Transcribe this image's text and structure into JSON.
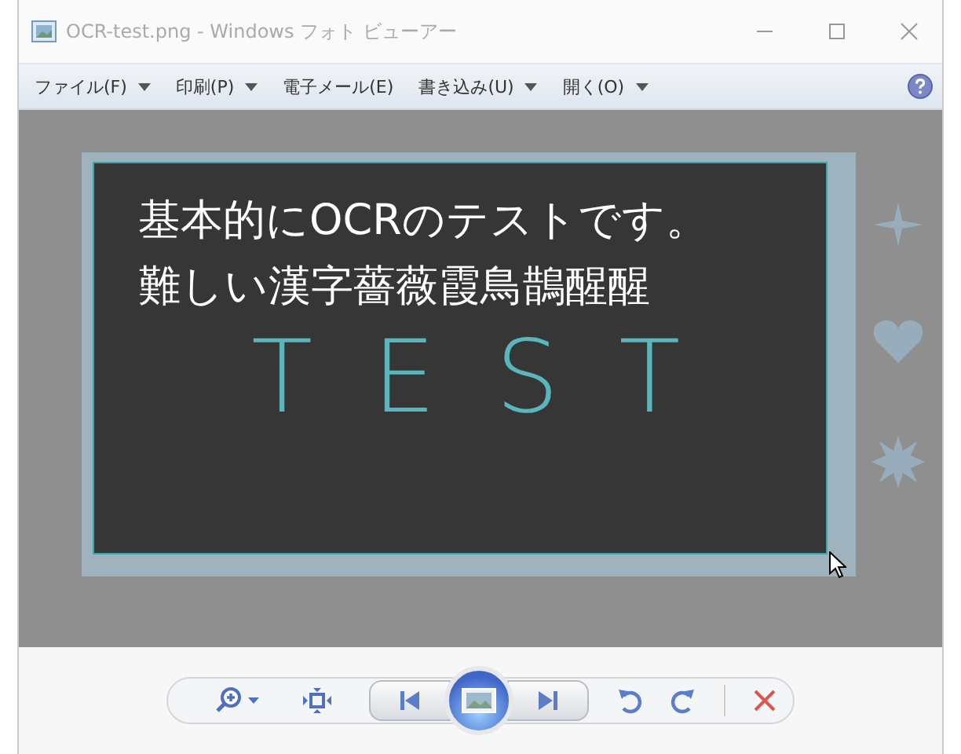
{
  "window": {
    "title": "OCR-test.png - Windows フォト ビューアー"
  },
  "menu": [
    {
      "label": "ファイル(F)",
      "kind": "dropdown"
    },
    {
      "label": "印刷(P)",
      "kind": "dropdown"
    },
    {
      "label": "電子メール(E)",
      "kind": "plain"
    },
    {
      "label": "書き込み(U)",
      "kind": "dropdown"
    },
    {
      "label": "開く(O)",
      "kind": "dropdown"
    }
  ],
  "image": {
    "lines": [
      "基本的にOCRのテストです。",
      "難しい漢字薔薇霞鳥鵲醒醒"
    ],
    "handwriting": "TEST"
  }
}
